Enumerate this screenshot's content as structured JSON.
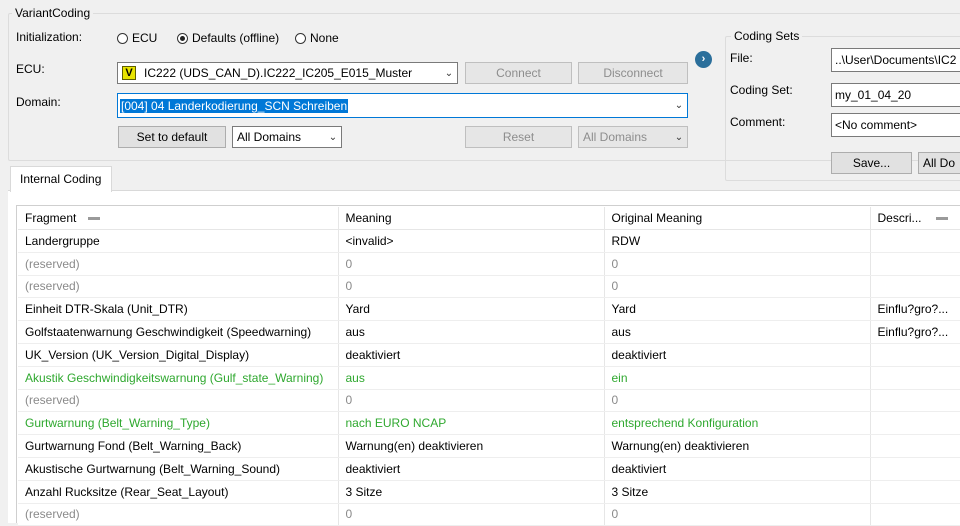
{
  "variant_coding": {
    "title": "VariantCoding",
    "init_label": "Initialization:",
    "radios": [
      {
        "label": "ECU",
        "selected": false
      },
      {
        "label": "Defaults (offline)",
        "selected": true
      },
      {
        "label": "None",
        "selected": false
      }
    ],
    "ecu_label": "ECU:",
    "ecu_badge": "V",
    "ecu_value": "IC222 (UDS_CAN_D).IC222_IC205_E015_Muster",
    "connect_label": "Connect",
    "disconnect_label": "Disconnect",
    "domain_label": "Domain:",
    "domain_value": "[004] 04 Landerkodierung_SCN Schreiben",
    "set_default_label": "Set to default",
    "all_domains_left": "All Domains",
    "reset_label": "Reset",
    "all_domains_right": "All Domains"
  },
  "coding_sets": {
    "title": "Coding Sets",
    "file_label": "File:",
    "file_value": "..\\User\\Documents\\IC2",
    "set_label": "Coding Set:",
    "set_value": "my_01_04_20",
    "comment_label": "Comment:",
    "comment_value": "<No comment>",
    "save_label": "Save...",
    "all_do_label": "All Do"
  },
  "tabs": [
    "Internal Coding"
  ],
  "table": {
    "headers": [
      "Fragment",
      "Meaning",
      "Original Meaning",
      "Descri..."
    ],
    "rows": [
      {
        "fragment": "Landergruppe",
        "meaning": "<invalid>",
        "original": "RDW",
        "desc": "",
        "style": "normal"
      },
      {
        "fragment": "(reserved)",
        "meaning": "0",
        "original": "0",
        "desc": "",
        "style": "gray"
      },
      {
        "fragment": "(reserved)",
        "meaning": "0",
        "original": "0",
        "desc": "",
        "style": "gray"
      },
      {
        "fragment": "Einheit DTR-Skala (Unit_DTR)",
        "meaning": "Yard",
        "original": "Yard",
        "desc": "Einflu?gro?...",
        "style": "normal"
      },
      {
        "fragment": "Golfstaatenwarnung Geschwindigkeit (Speedwarning)",
        "meaning": "aus",
        "original": "aus",
        "desc": "Einflu?gro?...",
        "style": "normal"
      },
      {
        "fragment": "UK_Version (UK_Version_Digital_Display)",
        "meaning": "deaktiviert",
        "original": "deaktiviert",
        "desc": "",
        "style": "normal"
      },
      {
        "fragment": "Akustik Geschwindigkeitswarnung (Gulf_state_Warning)",
        "meaning": "aus",
        "original": "ein",
        "desc": "",
        "style": "green"
      },
      {
        "fragment": "(reserved)",
        "meaning": "0",
        "original": "0",
        "desc": "",
        "style": "gray"
      },
      {
        "fragment": "Gurtwarnung (Belt_Warning_Type)",
        "meaning": "nach EURO NCAP",
        "original": "entsprechend Konfiguration",
        "desc": "",
        "style": "green"
      },
      {
        "fragment": "Gurtwarnung Fond (Belt_Warning_Back)",
        "meaning": "Warnung(en) deaktivieren",
        "original": "Warnung(en) deaktivieren",
        "desc": "",
        "style": "normal"
      },
      {
        "fragment": "Akustische Gurtwarnung (Belt_Warning_Sound)",
        "meaning": "deaktiviert",
        "original": "deaktiviert",
        "desc": "",
        "style": "normal"
      },
      {
        "fragment": "Anzahl Rucksitze (Rear_Seat_Layout)",
        "meaning": "3 Sitze",
        "original": "3 Sitze",
        "desc": "",
        "style": "normal"
      },
      {
        "fragment": "(reserved)",
        "meaning": "0",
        "original": "0",
        "desc": "",
        "style": "gray"
      }
    ]
  },
  "colors": {
    "accent": "#2b6f9b",
    "changed": "#2fa82f",
    "selection": "#0078d7",
    "ecu_badge": "#e8e400"
  }
}
